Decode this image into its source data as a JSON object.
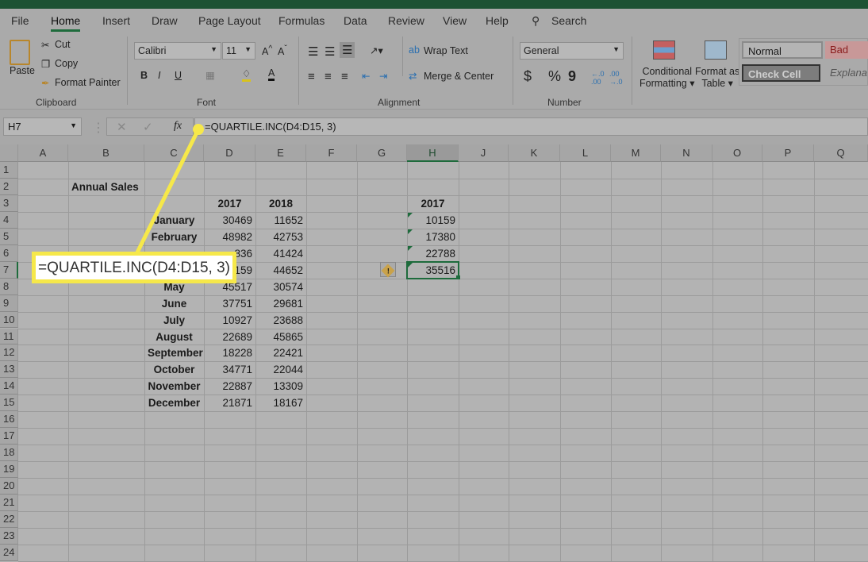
{
  "tabs": [
    "File",
    "Home",
    "Insert",
    "Draw",
    "Page Layout",
    "Formulas",
    "Data",
    "Review",
    "View",
    "Help"
  ],
  "search_label": "Search",
  "clipboard": {
    "paste": "Paste",
    "cut": "Cut",
    "copy": "Copy",
    "format_painter": "Format Painter",
    "group": "Clipboard"
  },
  "font": {
    "name": "Calibri",
    "size": "11",
    "bold": "B",
    "italic": "I",
    "underline": "U",
    "group": "Font"
  },
  "alignment": {
    "wrap": "Wrap Text",
    "merge": "Merge & Center",
    "group": "Alignment"
  },
  "number": {
    "format": "General",
    "currency": "$",
    "percent": "%",
    "comma": "9",
    "group": "Number"
  },
  "styles": {
    "conditional": "Conditional",
    "conditional2": "Formatting",
    "format_table": "Format as",
    "format_table2": "Table",
    "normal": "Normal",
    "bad": "Bad",
    "check": "Check Cell",
    "explanatory": "Explana"
  },
  "formula_bar": {
    "name_box": "H7",
    "formula": "=QUARTILE.INC(D4:D15, 3)"
  },
  "callout": "=QUARTILE.INC(D4:D15, 3)",
  "columns": [
    "A",
    "B",
    "C",
    "D",
    "E",
    "F",
    "G",
    "H",
    "J",
    "K",
    "L",
    "M",
    "N",
    "O",
    "P",
    "Q"
  ],
  "rows": [
    "1",
    "2",
    "3",
    "4",
    "5",
    "6",
    "7",
    "8",
    "9",
    "10",
    "11",
    "12",
    "13",
    "14",
    "15",
    "16",
    "17",
    "18",
    "19",
    "20",
    "21",
    "22",
    "23",
    "24"
  ],
  "sheet": {
    "title": "Annual Sales",
    "year_headers": [
      "2017",
      "2018"
    ],
    "months": [
      "January",
      "February",
      "",
      "",
      "May",
      "June",
      "July",
      "August",
      "September",
      "October",
      "November",
      "December"
    ],
    "d": [
      "30469",
      "48982",
      "836",
      "159",
      "45517",
      "37751",
      "10927",
      "22689",
      "18228",
      "34771",
      "22887",
      "21871"
    ],
    "e": [
      "11652",
      "42753",
      "41424",
      "44652",
      "30574",
      "29681",
      "23688",
      "45865",
      "22421",
      "22044",
      "13309",
      "18167"
    ],
    "h_header": "2017",
    "h": [
      "10159",
      "17380",
      "22788",
      "35516"
    ]
  },
  "colors": {
    "accent": "#1e6b3c",
    "callout": "#f6e84a"
  }
}
